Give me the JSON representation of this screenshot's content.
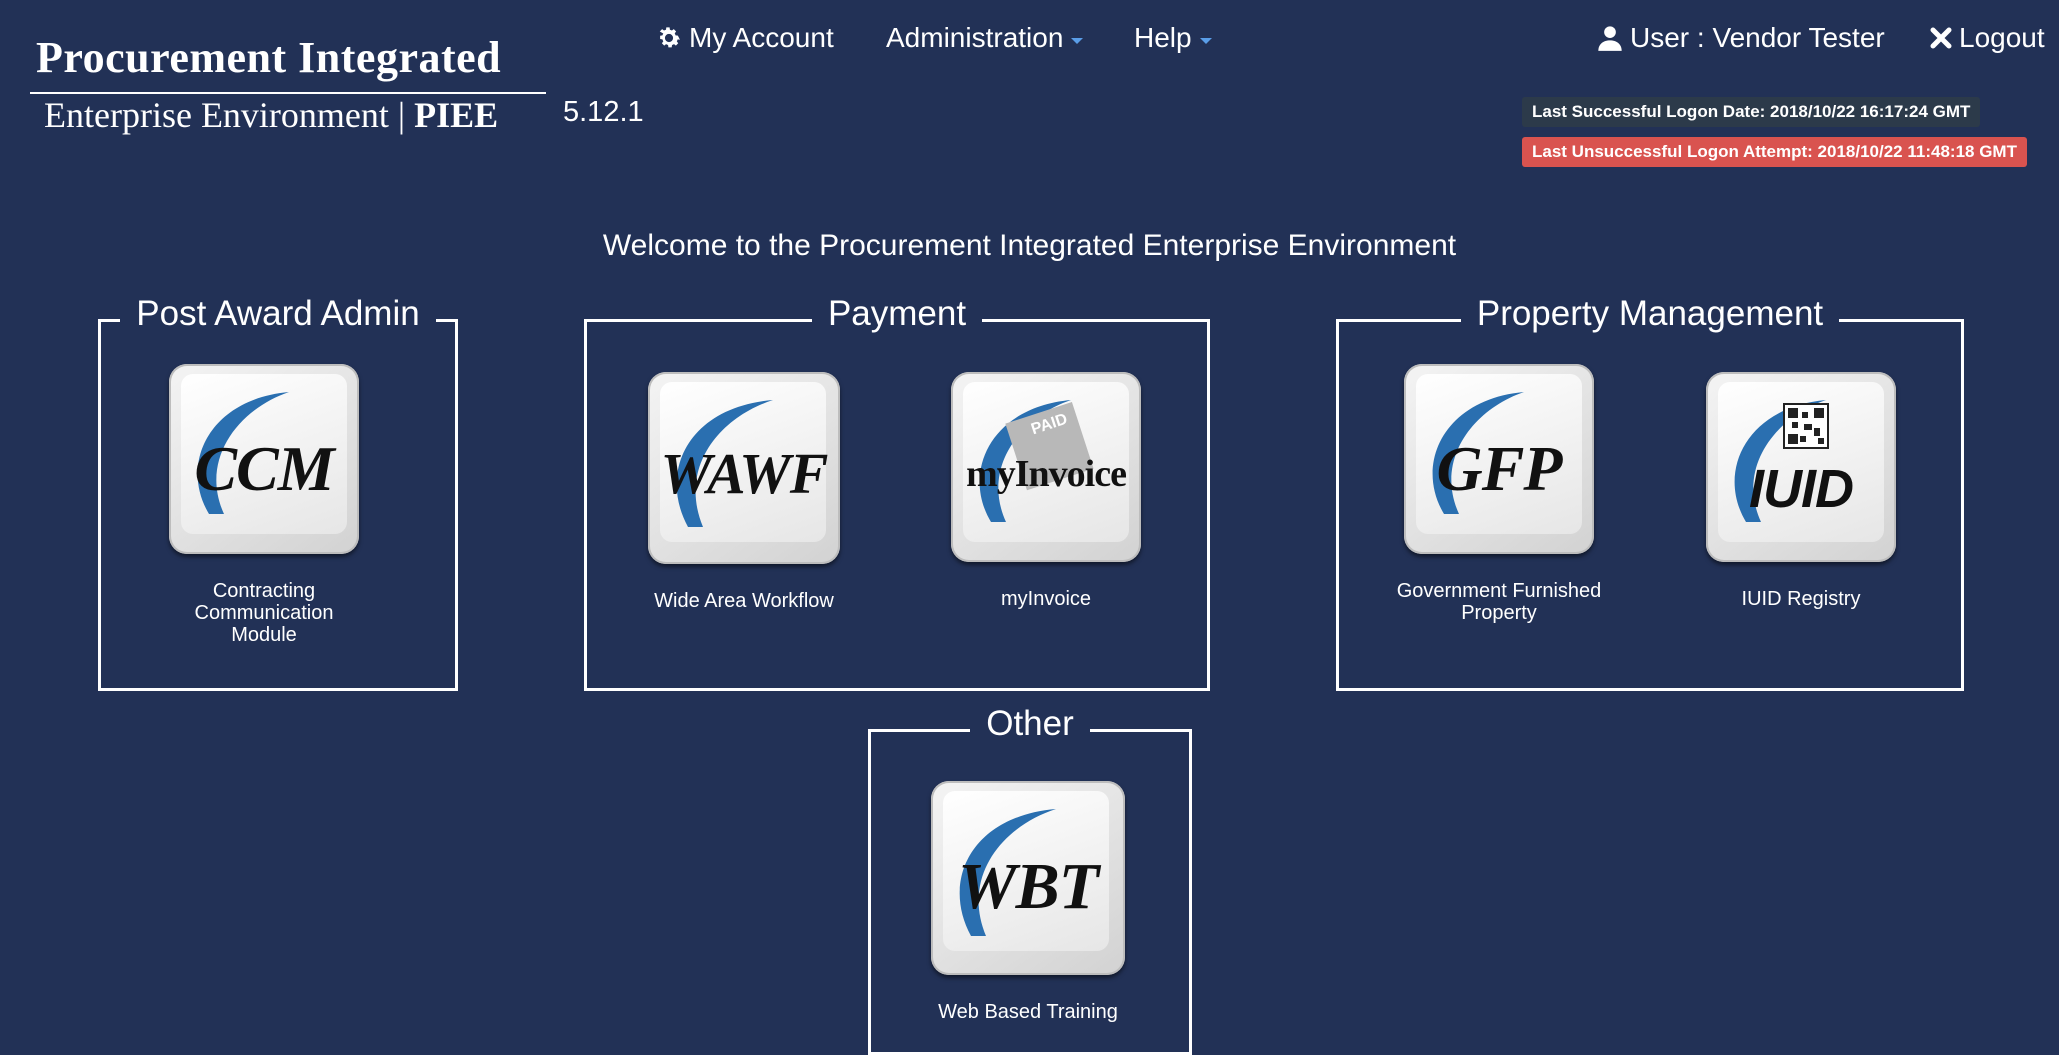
{
  "header": {
    "logo_line1": "Procurement Integrated",
    "logo_line2_prefix": "Enterprise Environment | ",
    "logo_line2_bold": "PIEE",
    "version": "5.12.1"
  },
  "nav": {
    "my_account": "My Account",
    "administration": "Administration",
    "help": "Help",
    "user": "User : Vendor Tester",
    "logout": "Logout"
  },
  "logon": {
    "success": "Last Successful Logon Date: 2018/10/22 16:17:24 GMT",
    "failure": "Last Unsuccessful Logon Attempt: 2018/10/22 11:48:18 GMT"
  },
  "welcome": "Welcome to the Procurement Integrated Enterprise Environment",
  "groups": {
    "post_award": {
      "title": "Post Award Admin",
      "tiles": [
        {
          "key": "CCM",
          "caption_line1": "Contracting",
          "caption_line2": "Communication Module"
        }
      ]
    },
    "payment": {
      "title": "Payment",
      "tiles": [
        {
          "key": "WAWF",
          "caption": "Wide Area Workflow"
        },
        {
          "key": "myInvoice",
          "caption": "myInvoice",
          "stamp": "PAID"
        }
      ]
    },
    "property": {
      "title": "Property Management",
      "tiles": [
        {
          "key": "GFP",
          "caption_line1": "Government Furnished",
          "caption_line2": "Property"
        },
        {
          "key": "IUID",
          "caption": "IUID Registry"
        }
      ]
    },
    "other": {
      "title": "Other",
      "tiles": [
        {
          "key": "WBT",
          "caption": "Web Based Training"
        }
      ]
    }
  },
  "colors": {
    "background": "#223156",
    "swoosh": "#2a6fb0",
    "failure_badge": "#d9534f",
    "success_badge": "#2c3a4a",
    "caret": "#5a9ee8"
  },
  "icons": [
    "gear-icon",
    "user-icon",
    "close-icon",
    "chevron-down-icon",
    "qr-code-icon"
  ]
}
